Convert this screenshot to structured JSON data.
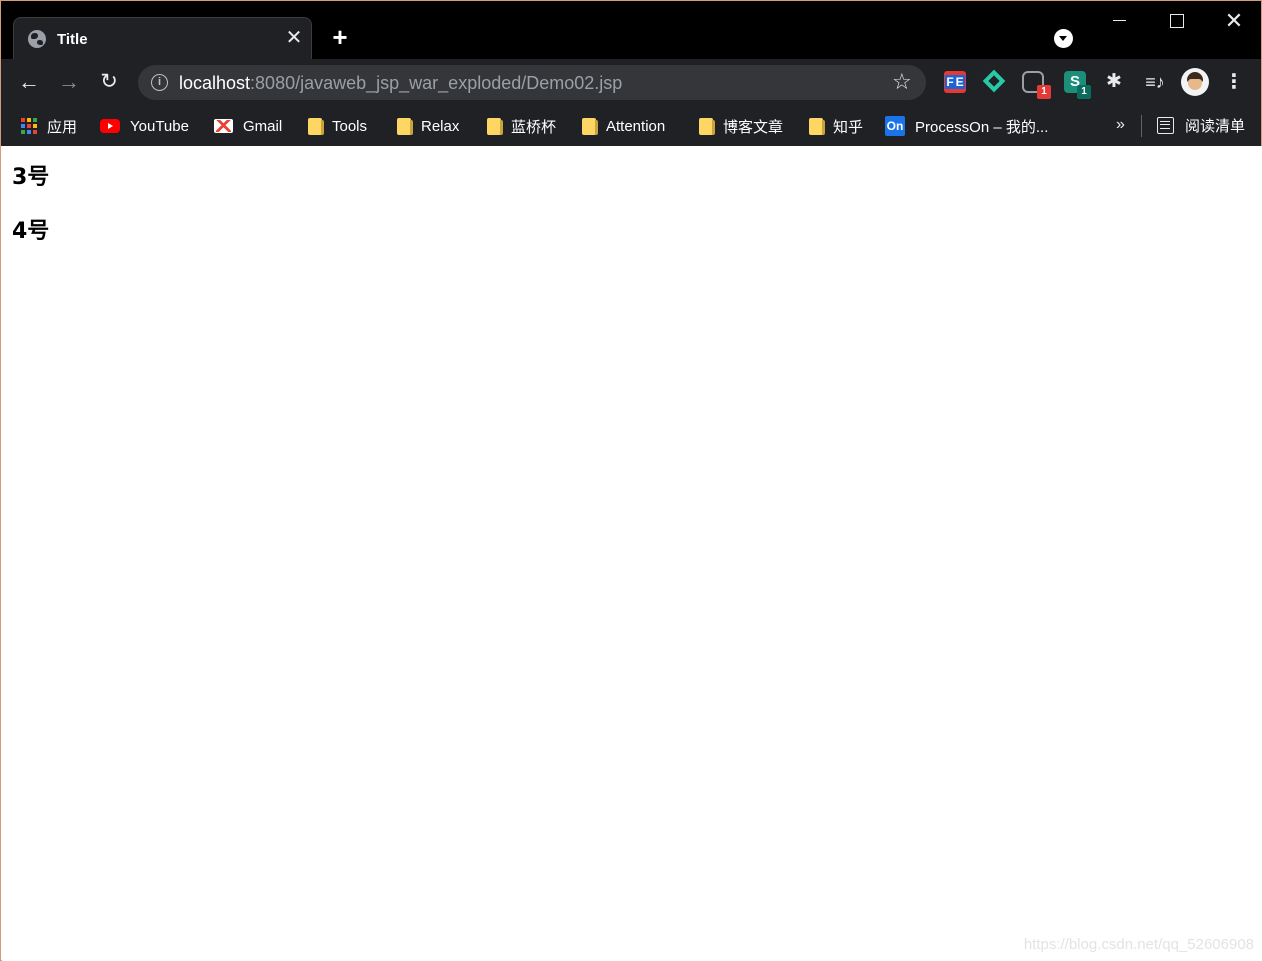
{
  "browser": {
    "tab": {
      "title": "Title",
      "close_glyph": "✕"
    },
    "new_tab_glyph": "+",
    "window_controls": {
      "close_glyph": "✕"
    },
    "nav": {
      "back_glyph": "←",
      "forward_glyph": "→",
      "reload_glyph": "↻"
    },
    "omnibox": {
      "info_glyph": "i",
      "url_host": "localhost",
      "url_path": ":8080/javaweb_jsp_war_exploded/Demo02.jsp",
      "star_glyph": "☆"
    },
    "extensions": {
      "fe_label_f": "F",
      "fe_label_e": "E",
      "ghost_badge": "1",
      "s_label": "S",
      "s_badge": "1",
      "puzzle_glyph": "✱",
      "media_glyph": "≡♪",
      "menu_glyph": "⋮"
    },
    "bookmarks": [
      {
        "label": "应用",
        "icon": "apps-grid-icon"
      },
      {
        "label": "YouTube",
        "icon": "youtube-icon"
      },
      {
        "label": "Gmail",
        "icon": "gmail-icon"
      },
      {
        "label": "Tools",
        "icon": "folder-icon"
      },
      {
        "label": "Relax",
        "icon": "folder-icon"
      },
      {
        "label": "蓝桥杯",
        "icon": "folder-icon"
      },
      {
        "label": "Attention",
        "icon": "folder-icon"
      },
      {
        "label": "博客文章",
        "icon": "folder-icon"
      },
      {
        "label": "知乎",
        "icon": "folder-icon"
      },
      {
        "label": "ProcessOn – 我的...",
        "icon": "processon-icon",
        "icon_text": "On"
      }
    ],
    "bookmarks_more_glyph": "»",
    "reading_list_label": "阅读清单",
    "colors": {
      "frame": "#000000",
      "toolbar": "#202124",
      "omnibox": "#35363a",
      "folder": "#fdd663",
      "youtube": "#ff0000",
      "processon": "#1a73e8"
    }
  },
  "page": {
    "headings": [
      "3号",
      "4号"
    ],
    "watermark": "https://blog.csdn.net/qq_52606908"
  }
}
